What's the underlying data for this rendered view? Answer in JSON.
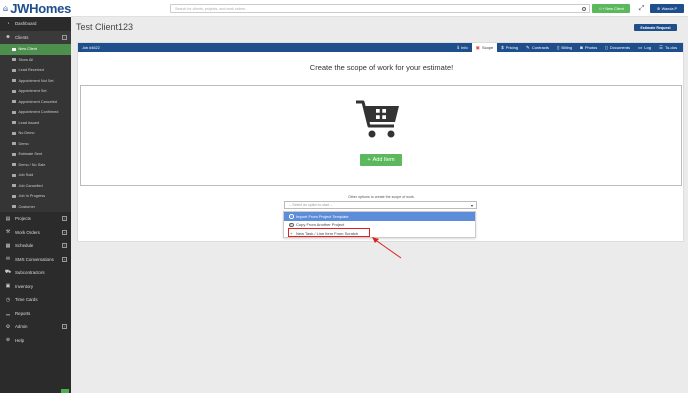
{
  "app": {
    "logo_text": "JWHomes",
    "brand_color": "#1f4e8c"
  },
  "topbar": {
    "search_placeholder": "Search for clients, projects, and work orders",
    "new_client_label": "New Client",
    "user_label": "Wanda P"
  },
  "sidebar": {
    "dashboard": "Dashboard",
    "clients": "Clients",
    "client_items": [
      "New Client",
      "Show All",
      "Lead Received",
      "Appointment Not Set",
      "Appointment Set",
      "Appointment Canceled",
      "Appointment Confirmed",
      "Lead Issued",
      "No Demo",
      "Demo",
      "Estimate Sent",
      "Demo / No Sale",
      "Job Sold",
      "Job Cancelled",
      "Job In Progress",
      "Customer"
    ],
    "bottom_items": [
      "Projects",
      "Work Orders",
      "Schedule",
      "SMS Conversations",
      "Subcontractors",
      "Inventory",
      "Time Cards",
      "Reports",
      "Admin",
      "Help"
    ]
  },
  "page": {
    "title": "Test Client123",
    "estimate_request_label": "Estimate Request"
  },
  "job": {
    "label": "Job #4622",
    "tabs": [
      {
        "label": "Info",
        "icon": "info-icon"
      },
      {
        "label": "Scope",
        "icon": "scope-icon"
      },
      {
        "label": "Pricing",
        "icon": "dollar-icon"
      },
      {
        "label": "Contracts",
        "icon": "contract-icon"
      },
      {
        "label": "Billing",
        "icon": "billing-icon"
      },
      {
        "label": "Photos",
        "icon": "camera-icon"
      },
      {
        "label": "Documents",
        "icon": "document-icon"
      },
      {
        "label": "Log",
        "icon": "chat-icon"
      },
      {
        "label": "To-dos",
        "icon": "list-icon"
      }
    ]
  },
  "scope": {
    "heading": "Create the scope of work for your estimate!",
    "add_item_label": "Add Item",
    "other_options_label": "Other options to create the scope of work.",
    "select_placeholder": "-- Select an option to start --",
    "options": [
      "Import From Project Template",
      "Copy From Another Project",
      "New Task / Line Item From Scratch"
    ]
  }
}
